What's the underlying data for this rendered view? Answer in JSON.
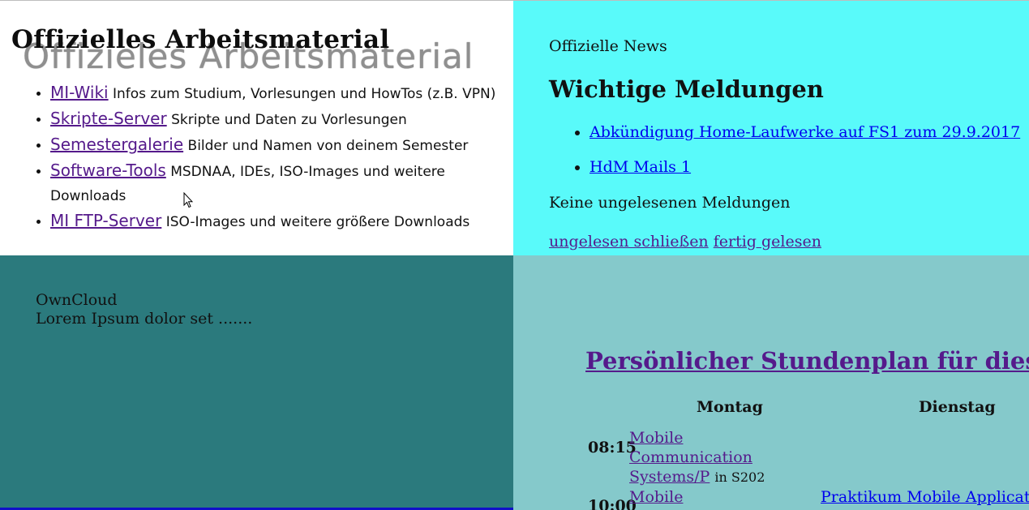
{
  "material": {
    "title": "Offizielles Arbeitsmaterial",
    "title_banner": "Offizieles Arbeitsmaterial",
    "items": [
      {
        "link": "MI-Wiki",
        "desc": " Infos zum Studium, Vorlesungen und HowTos (z.B. VPN)"
      },
      {
        "link": "Skripte-Server",
        "desc": " Skripte und Daten zu Vorlesungen"
      },
      {
        "link": "Semestergalerie",
        "desc": " Bilder und Namen von deinem Semester"
      },
      {
        "link": "Software-Tools",
        "desc": " MSDNAA, IDEs, ISO-Images und weitere Downloads"
      },
      {
        "link": "MI FTP-Server",
        "desc": " ISO-Images und weitere größere Downloads"
      }
    ]
  },
  "news": {
    "label": "Offizielle News",
    "heading": "Wichtige Meldungen",
    "items": [
      "Abkündigung Home-Laufwerke auf FS1 zum 29.9.2017",
      "HdM Mails 1"
    ],
    "empty": "Keine ungelesenen Meldungen",
    "action_close": "ungelesen schließen",
    "action_done": "fertig gelesen"
  },
  "cloud": {
    "title": "OwnCloud",
    "text": "Lorem Ipsum dolor set ......."
  },
  "schedule": {
    "title": "Persönlicher Stundenplan für diese Woche",
    "days": [
      "Montag",
      "Dienstag"
    ],
    "rows": [
      {
        "time": "08:15",
        "monday": "Mobile Communication Systems/P",
        "monday_room": "in S202",
        "tuesday": ""
      },
      {
        "time": "10:00",
        "monday": "Mobile Communication",
        "monday_room": "",
        "tuesday": "Praktikum Mobile Applications/P"
      }
    ]
  },
  "colors": {
    "news_bg": "#59fafa",
    "cloud_bg": "#2b7a7d",
    "schedule_bg": "#85c9cb"
  }
}
